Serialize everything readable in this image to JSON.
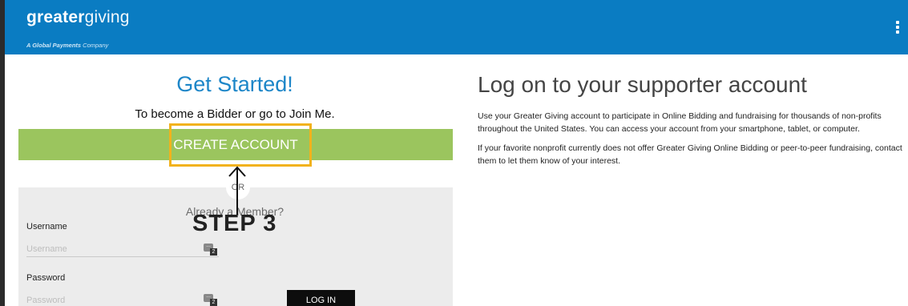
{
  "brand": {
    "logo_bold": "greater",
    "logo_light": "giving",
    "tagline_bold": "A Global Payments",
    "tagline_rest": "Company"
  },
  "left": {
    "title": "Get Started!",
    "subtitle": "To become a Bidder or go to Join Me.",
    "create_account_label": "CREATE ACCOUNT",
    "or_label": "OR",
    "already_member": "Already a Member?",
    "annotation": "STEP 3",
    "username_label": "Username",
    "username_placeholder": "Username",
    "password_label": "Password",
    "password_placeholder": "Password",
    "password_manager_badge": "2",
    "login_label": "LOG IN"
  },
  "right": {
    "heading": "Log on to your supporter account",
    "paragraph1": "Use your Greater Giving account to participate in Online Bidding and fundraising for thousands of non-profits throughout the United States. You can access your account from your smartphone, tablet, or computer.",
    "paragraph2": "If your favorite nonprofit currently does not offer Greater Giving Online Bidding or peer-to-peer fundraising, contact them to let them know of your interest."
  },
  "colors": {
    "header_blue": "#0a7cc2",
    "title_blue": "#1d86c8",
    "create_green": "#9bc55e",
    "highlight_orange": "#f2b21c",
    "login_black": "#0d0d0d"
  },
  "icons": {
    "menu": "kebab-menu-icon",
    "password_manager": "keyboard-password-manager-icon",
    "annotation_arrow": "up-arrow-icon"
  }
}
